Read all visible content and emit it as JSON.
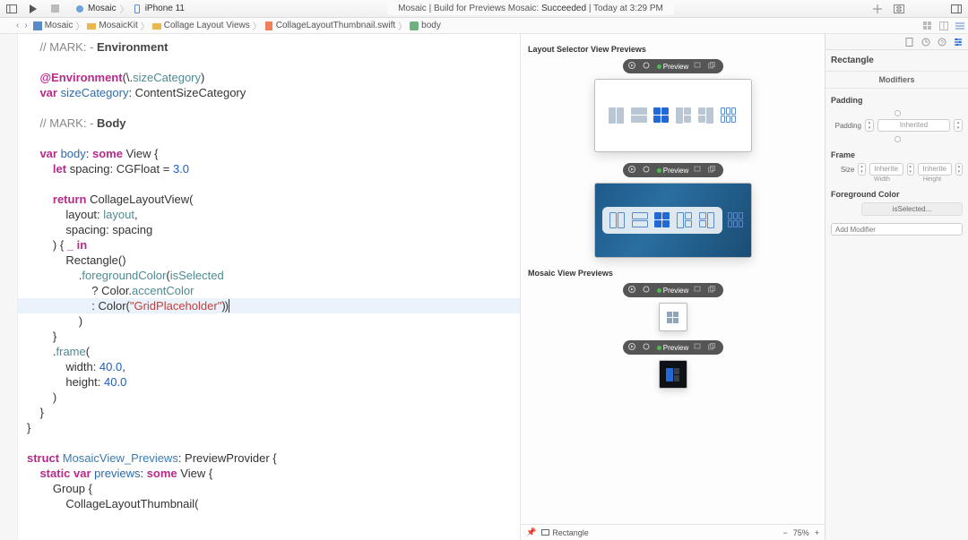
{
  "toolbar": {
    "scheme_app": "Mosaic",
    "scheme_device": "iPhone 11",
    "status_prefix": "Mosaic | Build for Previews Mosaic: ",
    "status_result": "Succeeded",
    "status_time": " | Today at 3:29 PM"
  },
  "breadcrumb": {
    "items": [
      "Mosaic",
      "MosaicKit",
      "Collage Layout Views",
      "CollageLayoutThumbnail.swift",
      "body"
    ]
  },
  "code": {
    "l01a": "    // MARK: - ",
    "l01b": "Environment",
    "l03": "    @Environment(\\.sizeCategory)",
    "l04a": "    var",
    "l04b": " sizeCategory",
    "l04c": ": ContentSizeCategory",
    "l06a": "    // MARK: - ",
    "l06b": "Body",
    "l08a": "    var",
    "l08b": " body",
    "l08c": ": ",
    "l08d": "some",
    "l08e": " View {",
    "l09a": "        let",
    "l09b": " spacing: CGFloat = ",
    "l09c": "3.0",
    "l11a": "        return",
    "l11b": " CollageLayoutView(",
    "l12": "            layout: layout,",
    "l13": "            spacing: spacing",
    "l14a": "        ) { ",
    "l14b": "_",
    "l14c": " in",
    "l15": "            Rectangle()",
    "l16a": "                .foregroundColor(",
    "l16b": "isSelected",
    "l17a": "                    ? Color.",
    "l17b": "accentColor",
    "l18a": "                    : Color(",
    "l18b": "\"GridPlaceholder\"",
    "l18c": "))",
    "l19": "                )",
    "l20": "        }",
    "l21": "        .frame(",
    "l22a": "            width: ",
    "l22b": "40.0",
    "l22c": ",",
    "l23a": "            height: ",
    "l23b": "40.0",
    "l24": "        )",
    "l25": "    }",
    "l26": "}",
    "l28a": "struct",
    "l28b": " MosaicView_Previews",
    "l28c": ": PreviewProvider {",
    "l29a": "    static var",
    "l29b": " previews",
    "l29c": ": ",
    "l29d": "some",
    "l29e": " View {",
    "l30": "        Group {",
    "l31": "            CollageLayoutThumbnail("
  },
  "canvas": {
    "section1": "Layout Selector View Previews",
    "section2": "Mosaic View Previews",
    "preview_label": "Preview",
    "footer_item": "Rectangle",
    "zoom": "75%"
  },
  "inspector": {
    "title": "Rectangle",
    "modifiers": "Modifiers",
    "padding_section": "Padding",
    "padding_label": "Padding",
    "inherited": "Inherited",
    "frame_section": "Frame",
    "size_label": "Size",
    "inherite": "Inherite",
    "width": "Width",
    "height": "Height",
    "fg_section": "Foreground Color",
    "fg_value": "isSelected...",
    "add_modifier": "Add Modifier"
  }
}
